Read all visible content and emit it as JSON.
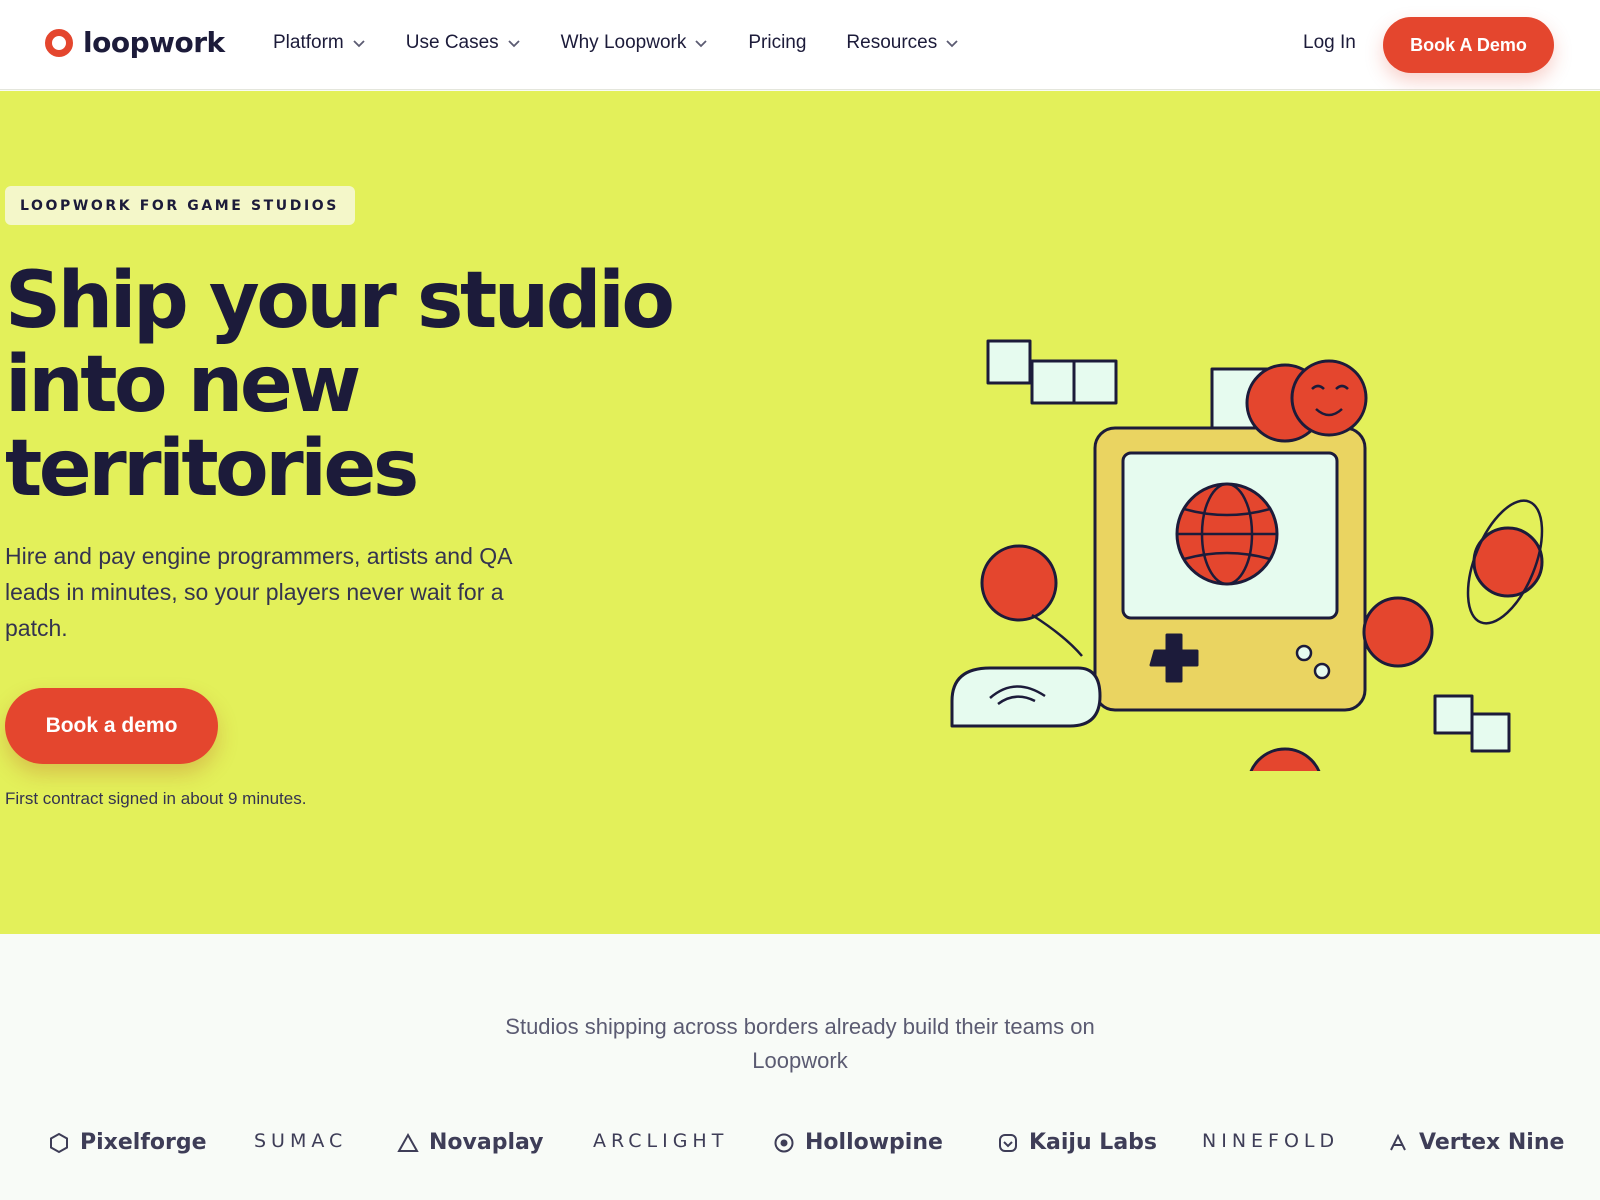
{
  "nav": {
    "brand": "loopwork",
    "links": [
      {
        "label": "Platform",
        "has_dropdown": true
      },
      {
        "label": "Use Cases",
        "has_dropdown": true
      },
      {
        "label": "Why Loopwork",
        "has_dropdown": true
      },
      {
        "label": "Pricing",
        "has_dropdown": false
      },
      {
        "label": "Resources",
        "has_dropdown": true
      }
    ],
    "login": "Log In",
    "cta": "Book A Demo"
  },
  "hero": {
    "badge": "LOOPWORK FOR GAME STUDIOS",
    "headline": "Ship your studio into new territories",
    "subtext": "Hire and pay engine programmers, artists and QA leads in minutes, so your players never wait for a patch.",
    "cta": "Book a demo",
    "note": "First contract signed in about 9 minutes."
  },
  "trust": {
    "text": "Studios shipping across borders already build their teams on Loopwork",
    "logos": [
      {
        "name": "Pixelforge",
        "icon": "hexagon-icon",
        "style": "bold"
      },
      {
        "name": "SUMAC",
        "icon": null,
        "style": "spaced"
      },
      {
        "name": "Novaplay",
        "icon": "triangle-icon",
        "style": "bold"
      },
      {
        "name": "ARCLIGHT",
        "icon": null,
        "style": "spaced"
      },
      {
        "name": "Hollowpine",
        "icon": "target-icon",
        "style": "bold"
      },
      {
        "name": "Kaiju Labs",
        "icon": "shield-check-icon",
        "style": "bold"
      },
      {
        "name": "NINEFOLD",
        "icon": null,
        "style": "spaced"
      },
      {
        "name": "Vertex Nine",
        "icon": "caret-icon",
        "style": "bold"
      }
    ]
  },
  "colors": {
    "accent": "#e4462e",
    "hero_bg": "#e3f05a",
    "ink": "#1c1b3a",
    "console": "#ead461",
    "screen": "#e6fbef"
  }
}
